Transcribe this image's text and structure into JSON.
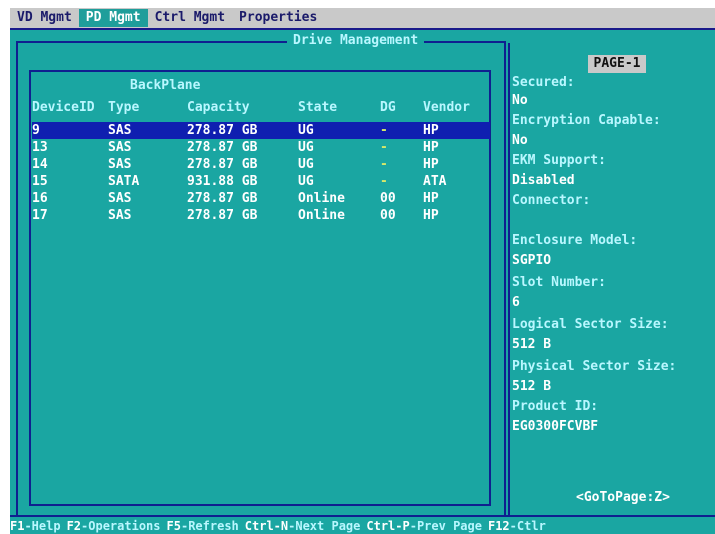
{
  "tabs": [
    {
      "label": "VD Mgmt"
    },
    {
      "label": "PD Mgmt",
      "active": true
    },
    {
      "label": "Ctrl Mgmt"
    },
    {
      "label": "Properties"
    }
  ],
  "panel_title": "Drive Management",
  "backplane_label": "BackPlane",
  "table": {
    "headers": [
      "DeviceID",
      "Type",
      "Capacity",
      "State",
      "DG",
      "Vendor"
    ],
    "rows": [
      {
        "id": "9",
        "type": "SAS",
        "capacity": "278.87 GB",
        "state": "UG",
        "dg": "-",
        "vendor": "HP",
        "selected": true
      },
      {
        "id": "13",
        "type": "SAS",
        "capacity": "278.87 GB",
        "state": "UG",
        "dg": "-",
        "vendor": "HP"
      },
      {
        "id": "14",
        "type": "SAS",
        "capacity": "278.87 GB",
        "state": "UG",
        "dg": "-",
        "vendor": "HP"
      },
      {
        "id": "15",
        "type": "SATA",
        "capacity": "931.88 GB",
        "state": "UG",
        "dg": "-",
        "vendor": "ATA"
      },
      {
        "id": "16",
        "type": "SAS",
        "capacity": "278.87 GB",
        "state": "Online",
        "dg": "00",
        "vendor": "HP"
      },
      {
        "id": "17",
        "type": "SAS",
        "capacity": "278.87 GB",
        "state": "Online",
        "dg": "00",
        "vendor": "HP"
      }
    ]
  },
  "properties": {
    "page": "PAGE-1",
    "items": [
      {
        "label": "Secured:",
        "value": "No"
      },
      {
        "label": "Encryption Capable:",
        "value": "No"
      },
      {
        "label": "EKM Support:",
        "value": "Disabled"
      },
      {
        "label": "Connector:",
        "value": ""
      },
      {
        "label": "Enclosure Model:",
        "value": "SGPIO"
      },
      {
        "label": "Slot Number:",
        "value": "6"
      },
      {
        "label": "Logical Sector Size:",
        "value": "512 B"
      },
      {
        "label": "Physical Sector Size:",
        "value": "512 B"
      },
      {
        "label": "Product ID:",
        "value": "EG0300FCVBF"
      }
    ],
    "goto": "<GoToPage:Z>"
  },
  "function_keys": [
    {
      "key": "F1",
      "label": "-Help"
    },
    {
      "key": "F2",
      "label": "-Operations"
    },
    {
      "key": "F5",
      "label": "-Refresh"
    },
    {
      "key": "Ctrl-N",
      "label": "-Next Page"
    },
    {
      "key": "Ctrl-P",
      "label": "-Prev Page"
    },
    {
      "key": "F12",
      "label": "-Ctlr"
    }
  ],
  "colors": {
    "background": "#1aa6a2",
    "selection": "#0f1fb0",
    "border": "#0f1f8f",
    "label_text": "#b9f7ff",
    "value_text": "#ffffff"
  }
}
